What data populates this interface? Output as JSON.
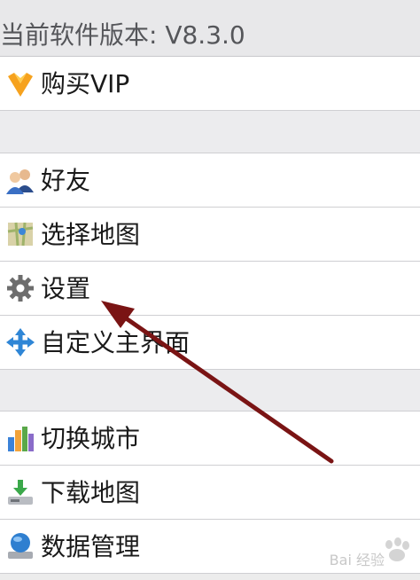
{
  "header": {
    "version_text": "当前软件版本: V8.3.0"
  },
  "menu": {
    "buy_vip": "购买VIP",
    "friends": "好友",
    "choose_map": "选择地图",
    "settings": "设置",
    "custom_home": "自定义主界面",
    "switch_city": "切换城市",
    "download_map": "下载地图",
    "data_management": "数据管理"
  },
  "watermark": {
    "text": "Bai 经验"
  },
  "colors": {
    "arrow": "#7a1414",
    "vip_orange": "#f5a623"
  }
}
